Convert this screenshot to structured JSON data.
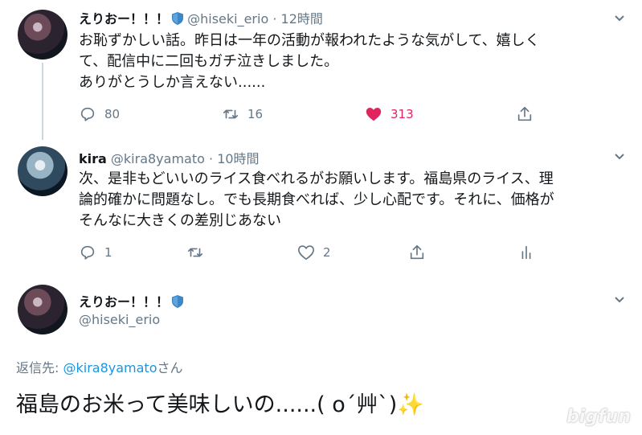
{
  "tweet1": {
    "name": "えりおー！！！",
    "handle": "@hiseki_erio",
    "dot": "·",
    "time": "12時間",
    "text_lines": [
      "お恥ずかしい話。昨日は一年の活動が報われたような気がして、嬉しく",
      "て、配信中に二回もガチ泣きしました。",
      "ありがとうしか言えない......"
    ],
    "reply_count": "80",
    "retweet_count": "16",
    "like_count": "313",
    "liked": true
  },
  "tweet2": {
    "name": "kira",
    "handle": "@kira8yamato",
    "dot": "·",
    "time": "10時間",
    "text_lines": [
      "次、是非もどいいのライス食べれるがお願いします。福島県のライス、理",
      "論的確かに問題なし。でも長期食べれば、少し心配です。それに、価格が",
      "そんなに大きくの差別じあない"
    ],
    "reply_count": "1",
    "like_count": "2"
  },
  "tweet3": {
    "name": "えりおー！！！",
    "handle": "@hiseki_erio",
    "replying_prefix": "返信先: ",
    "replying_handle": "@kira8yamato",
    "replying_suffix": "さん",
    "text": "福島のお米って美味しいの......( o´艸`)✨"
  },
  "watermark": "bigfun",
  "colors": {
    "verified": "#3b87c8",
    "like": "#e0245e",
    "link": "#1b95e0",
    "secondary": "#657786"
  },
  "icons": [
    "verified-badge-icon",
    "chevron-down-icon",
    "reply-icon",
    "retweet-icon",
    "heart-icon",
    "share-icon",
    "analytics-icon"
  ]
}
